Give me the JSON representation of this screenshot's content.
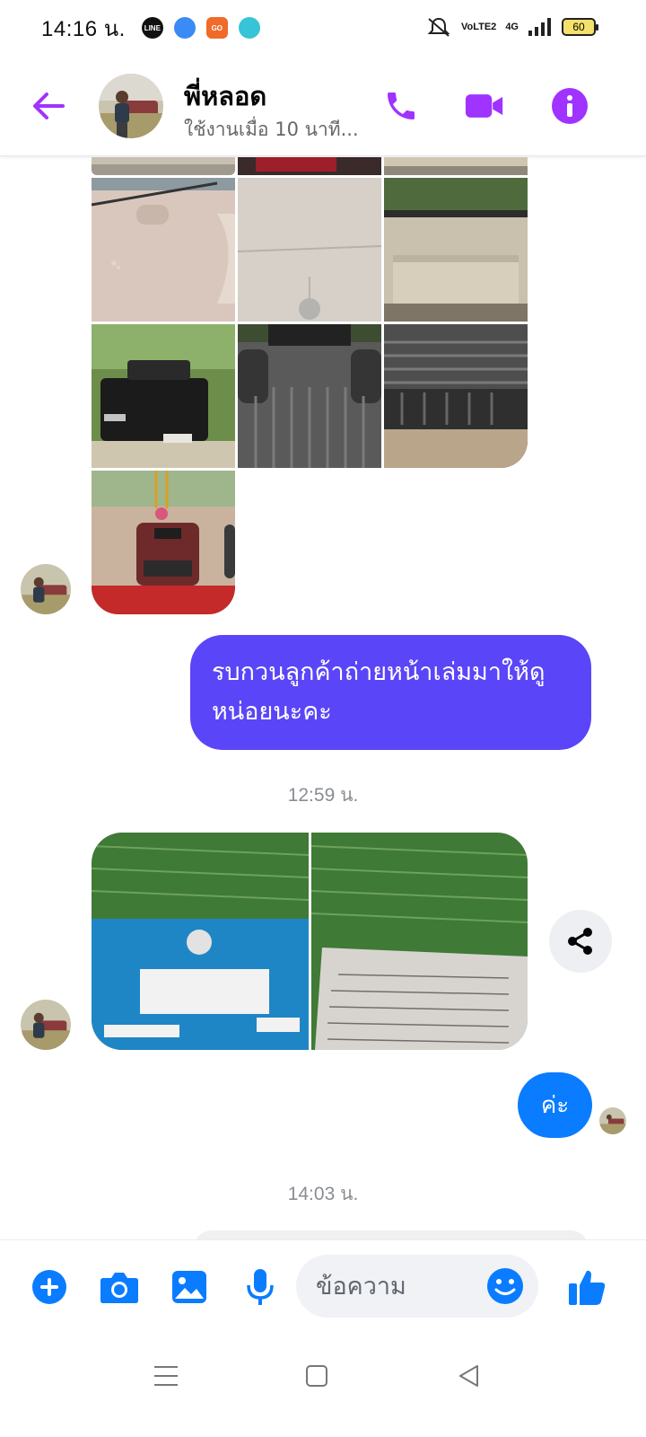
{
  "status_bar": {
    "time": "14:16 น.",
    "apps": [
      {
        "name": "line-icon",
        "label": "LINE",
        "color": "#111111"
      },
      {
        "name": "bluebird-icon",
        "label": "",
        "color": "#3b8bf5"
      },
      {
        "name": "godaily-icon",
        "label": "GO",
        "color": "#f06a2a"
      },
      {
        "name": "paw-app-icon",
        "label": "",
        "color": "#37c3d8"
      }
    ],
    "network_volte": "VoLTE2",
    "network_4g": "4G",
    "battery": "60"
  },
  "header": {
    "contact_name": "พี่หลอด",
    "contact_status": "ใช้งานเมื่อ 10 นาที...",
    "accent_color": "#a033ff"
  },
  "messages": {
    "outgoing_1": "รบกวนลูกค้าถ่ายหน้าเล่มมาให้ดูหน่อยนะคะ",
    "time_1": "12:59 น.",
    "reply_ka": "ค่ะ",
    "time_2": "14:03 น."
  },
  "composer": {
    "placeholder": "ข้อความ"
  },
  "colors": {
    "outgoing_bubble": "#5a45f8",
    "sent_bubble": "#0a7cff",
    "composer_icons": "#0a7cff"
  }
}
